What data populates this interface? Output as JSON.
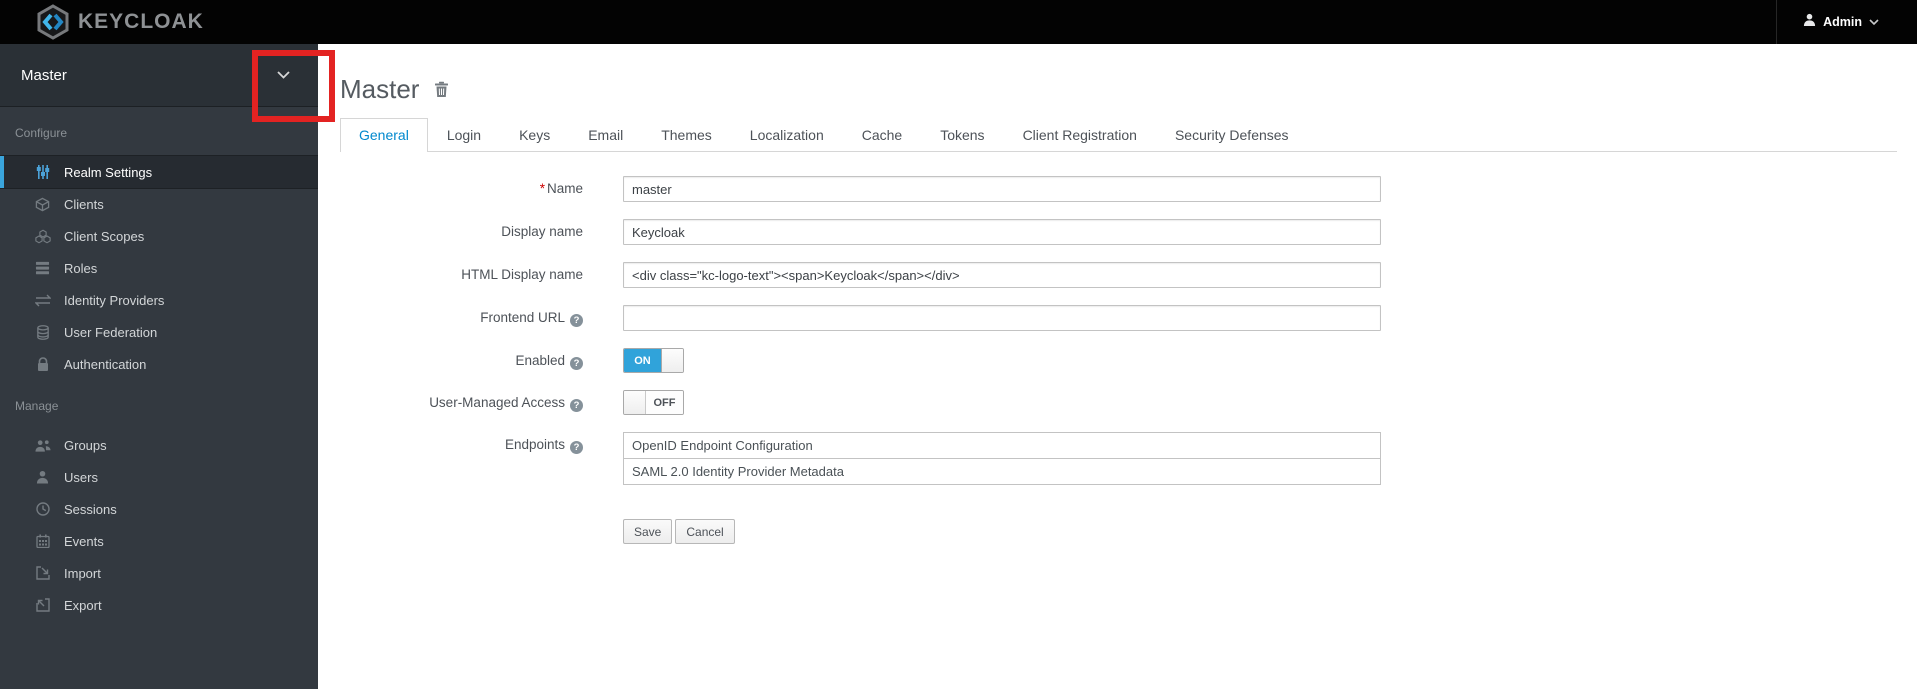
{
  "topbar": {
    "logo_text": "KEYCLOAK",
    "user_label": "Admin"
  },
  "sidebar": {
    "realm_selector": {
      "current_realm": "Master"
    },
    "sections": [
      {
        "label": "Configure",
        "items": [
          {
            "label": "Realm Settings",
            "icon": "sliders-icon",
            "active": true
          },
          {
            "label": "Clients",
            "icon": "cube-icon",
            "active": false
          },
          {
            "label": "Client Scopes",
            "icon": "cubes-icon",
            "active": false
          },
          {
            "label": "Roles",
            "icon": "list-icon",
            "active": false
          },
          {
            "label": "Identity Providers",
            "icon": "exchange-arrows-icon",
            "active": false
          },
          {
            "label": "User Federation",
            "icon": "database-icon",
            "active": false
          },
          {
            "label": "Authentication",
            "icon": "lock-icon",
            "active": false
          }
        ]
      },
      {
        "label": "Manage",
        "items": [
          {
            "label": "Groups",
            "icon": "group-icon",
            "active": false
          },
          {
            "label": "Users",
            "icon": "user-icon",
            "active": false
          },
          {
            "label": "Sessions",
            "icon": "clock-icon",
            "active": false
          },
          {
            "label": "Events",
            "icon": "calendar-icon",
            "active": false
          },
          {
            "label": "Import",
            "icon": "import-icon",
            "active": false
          },
          {
            "label": "Export",
            "icon": "export-icon",
            "active": false
          }
        ]
      }
    ]
  },
  "main": {
    "title": "Master",
    "tabs": [
      "General",
      "Login",
      "Keys",
      "Email",
      "Themes",
      "Localization",
      "Cache",
      "Tokens",
      "Client Registration",
      "Security Defenses"
    ],
    "active_tab": "General",
    "form": {
      "name": {
        "label": "Name",
        "required": "*",
        "value": "master"
      },
      "display_name": {
        "label": "Display name",
        "value": "Keycloak"
      },
      "html_display_name": {
        "label": "HTML Display name",
        "value": "<div class=\"kc-logo-text\"><span>Keycloak</span></div>"
      },
      "frontend_url": {
        "label": "Frontend URL",
        "value": ""
      },
      "enabled": {
        "label": "Enabled",
        "state": "ON"
      },
      "user_managed_access": {
        "label": "User-Managed Access",
        "state": "OFF"
      },
      "endpoints": {
        "label": "Endpoints",
        "links": [
          "OpenID Endpoint Configuration",
          "SAML 2.0 Identity Provider Metadata"
        ]
      },
      "save_label": "Save",
      "cancel_label": "Cancel"
    }
  },
  "annotation": {
    "shape": "red-rectangle",
    "target": "realm-selector-chevron"
  },
  "colors": {
    "topbar_bg": "#030303",
    "sidebar_bg": "#333940",
    "sidebar_active_bg": "#262b31",
    "active_nav_accent": "#3aa5dc",
    "tab_active_blue": "#0088ce",
    "toggle_on_blue": "#30a3da",
    "annotation_red": "#e32322"
  }
}
